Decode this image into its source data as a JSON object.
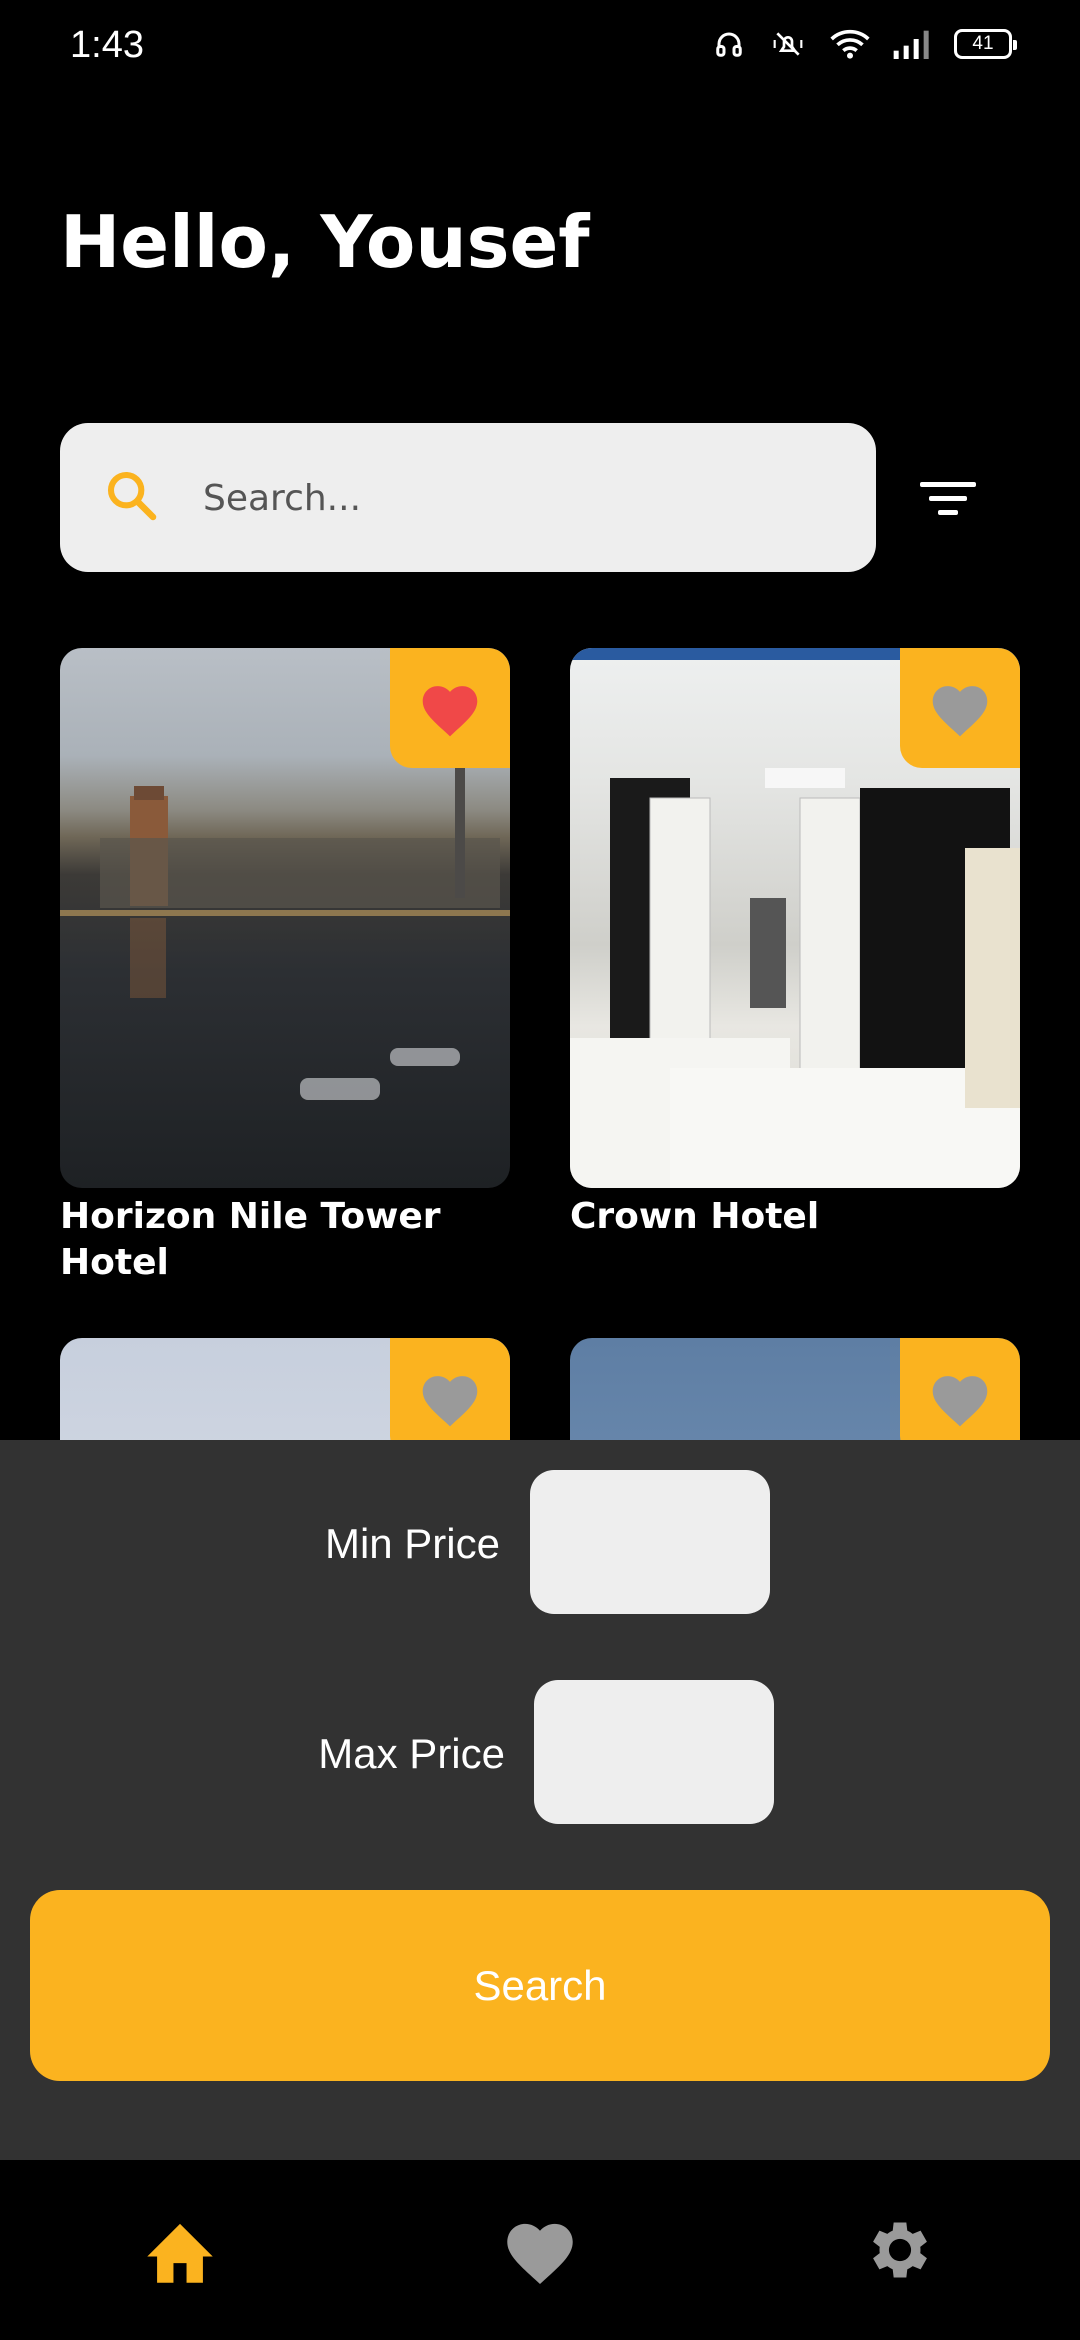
{
  "status_bar": {
    "time": "1:43",
    "battery": "41",
    "icons": [
      "headphones-icon",
      "mute-icon",
      "wifi-icon",
      "signal-icon",
      "battery-icon"
    ]
  },
  "header": {
    "greeting": "Hello, Yousef"
  },
  "search": {
    "placeholder": "Search...",
    "value": ""
  },
  "hotels": [
    {
      "name": "Horizon Nile Tower Hotel",
      "favorite": true
    },
    {
      "name": "Crown Hotel",
      "favorite": false
    },
    {
      "name": "",
      "favorite": false
    },
    {
      "name": "",
      "favorite": false
    }
  ],
  "filter_panel": {
    "min_price_label": "Min Price",
    "max_price_label": "Max Price",
    "min_price_value": "",
    "max_price_value": "",
    "search_button_label": "Search"
  },
  "bottom_nav": [
    {
      "icon": "home-icon",
      "active": true
    },
    {
      "icon": "heart-icon",
      "active": false
    },
    {
      "icon": "gear-icon",
      "active": false
    }
  ],
  "colors": {
    "accent": "#fbb31f",
    "favorite_active": "#f04848",
    "favorite_inactive": "#9a9a9a",
    "panel_bg": "#323232",
    "input_bg": "#eeeeee"
  }
}
